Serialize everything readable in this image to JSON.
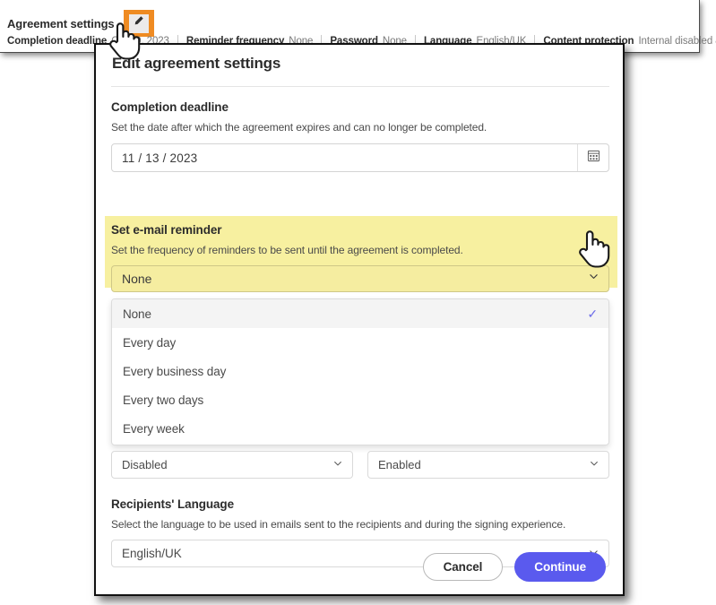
{
  "summary": {
    "title": "Agreement settings",
    "edit_icon": "pencil-icon",
    "fields": [
      {
        "label": "Completion deadline",
        "value": "Oct 20, 2023"
      },
      {
        "label": "Reminder frequency",
        "value": "None"
      },
      {
        "label": "Password",
        "value": "None"
      },
      {
        "label": "Language",
        "value": "English/UK"
      },
      {
        "label": "Content protection",
        "value": "Internal disabled & External enabled"
      }
    ]
  },
  "dialog": {
    "title": "Edit agreement settings",
    "deadline": {
      "heading": "Completion deadline",
      "description": "Set the date after which the agreement expires and can no longer be completed.",
      "value": "11 /  13 / 2023",
      "calendar_icon": "calendar-icon"
    },
    "reminder": {
      "heading": "Set e-mail reminder",
      "description": "Set the frequency of reminders to be sent until the agreement is completed.",
      "selected": "None",
      "highlight_color": "#f7f0a0",
      "chevron_icon": "chevron-down-icon",
      "options": [
        {
          "label": "None",
          "checked": true
        },
        {
          "label": "Every day",
          "checked": false
        },
        {
          "label": "Every business day",
          "checked": false
        },
        {
          "label": "Every two days",
          "checked": false
        },
        {
          "label": "Every week",
          "checked": false
        }
      ],
      "check_color": "#6c6ce8"
    },
    "small_selects": [
      {
        "value": "Disabled"
      },
      {
        "value": "Enabled"
      }
    ],
    "language": {
      "heading": "Recipients' Language",
      "description": "Select the language to be used in emails sent to the recipients and during the signing experience.",
      "value": "English/UK"
    },
    "footer": {
      "cancel_label": "Cancel",
      "continue_label": "Continue",
      "continue_color": "#5a5aee"
    }
  },
  "cursors": {
    "top": "hand-pointer-cursor",
    "dropdown": "hand-pointer-cursor"
  }
}
